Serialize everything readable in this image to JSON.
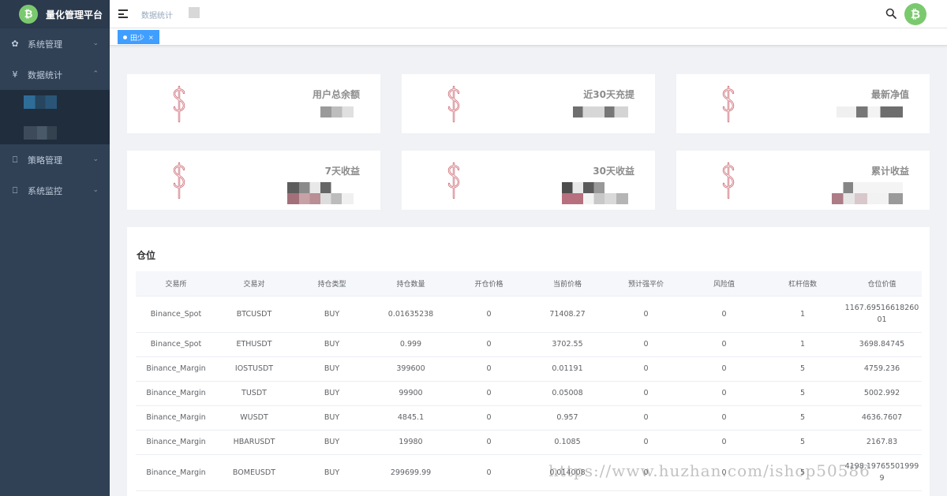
{
  "app": {
    "title": "量化管理平台",
    "logo_glyph": "₿",
    "accent_color": "#409eff",
    "brand_color": "#7bc96f"
  },
  "sidebar": {
    "items": [
      {
        "label": "系统管理",
        "icon": "gear-icon"
      },
      {
        "label": "数据统计",
        "icon": "yen-icon"
      },
      {
        "label": "策略管理",
        "icon": "monitor-icon"
      },
      {
        "label": "系统监控",
        "icon": "monitor-icon"
      }
    ]
  },
  "header": {
    "breadcrumb": "数据统计"
  },
  "tags": [
    {
      "label": "田少",
      "close": "×"
    }
  ],
  "stats": [
    {
      "title": "用户总余额"
    },
    {
      "title": "近30天充提"
    },
    {
      "title": "最新净值"
    },
    {
      "title": "7天收益"
    },
    {
      "title": "30天收益"
    },
    {
      "title": "累计收益"
    }
  ],
  "positions": {
    "title": "仓位",
    "columns": [
      "交易所",
      "交易对",
      "持仓类型",
      "持仓数量",
      "开仓价格",
      "当前价格",
      "预计强平价",
      "风险值",
      "杠杆倍数",
      "仓位价值"
    ],
    "rows": [
      [
        "Binance_Spot",
        "BTCUSDT",
        "BUY",
        "0.01635238",
        "0",
        "71408.27",
        "0",
        "0",
        "1",
        "1167.6951661826001"
      ],
      [
        "Binance_Spot",
        "ETHUSDT",
        "BUY",
        "0.999",
        "0",
        "3702.55",
        "0",
        "0",
        "1",
        "3698.84745"
      ],
      [
        "Binance_Margin",
        "IOSTUSDT",
        "BUY",
        "399600",
        "0",
        "0.01191",
        "0",
        "0",
        "5",
        "4759.236"
      ],
      [
        "Binance_Margin",
        "TUSDT",
        "BUY",
        "99900",
        "0",
        "0.05008",
        "0",
        "0",
        "5",
        "5002.992"
      ],
      [
        "Binance_Margin",
        "WUSDT",
        "BUY",
        "4845.1",
        "0",
        "0.957",
        "0",
        "0",
        "5",
        "4636.7607"
      ],
      [
        "Binance_Margin",
        "HBARUSDT",
        "BUY",
        "19980",
        "0",
        "0.1085",
        "0",
        "0",
        "5",
        "2167.83"
      ],
      [
        "Binance_Margin",
        "BOMEUSDT",
        "BUY",
        "299699.99",
        "0",
        "0.014008",
        "0",
        "0",
        "5",
        "4198.197655019999"
      ]
    ]
  },
  "watermark": "https://www.huzhan.com/ishop50586"
}
